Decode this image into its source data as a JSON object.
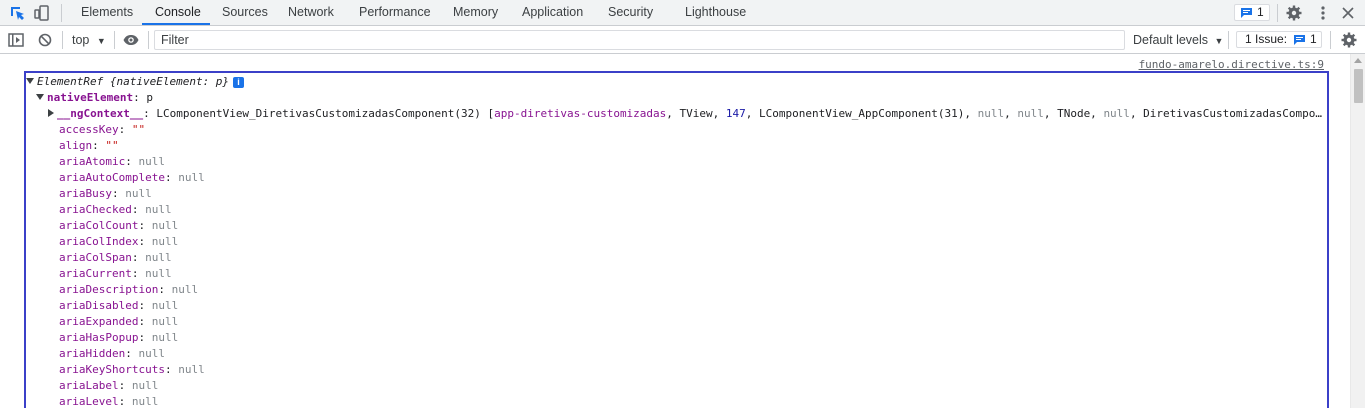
{
  "tabs": [
    {
      "label": "Elements"
    },
    {
      "label": "Console"
    },
    {
      "label": "Sources"
    },
    {
      "label": "Network"
    },
    {
      "label": "Performance"
    },
    {
      "label": "Memory"
    },
    {
      "label": "Application"
    },
    {
      "label": "Security"
    },
    {
      "label": "Lighthouse"
    }
  ],
  "active_tab": "Console",
  "messages_badge": "1",
  "toolbar": {
    "context": "top",
    "filter_placeholder": "Filter",
    "levels": "Default levels",
    "issues_label": "1 Issue:",
    "issues_count": "1"
  },
  "console": {
    "source_link": "fundo-amarelo.directive.ts:9",
    "header": "ElementRef {nativeElement: p}",
    "native_element_key": "nativeElement",
    "native_element_value": "p",
    "ng_context_key": "__ngContext__",
    "ng_context_value_parts": {
      "cls1": "LComponentView_DiretivasCustomizadasComponent(32) [",
      "sel": "app-diretivas-customizadas",
      "c1": ", TView, ",
      "n147": "147",
      "c2": ", LComponentView_AppComponent(31), ",
      "null1": "null",
      "c3": ", ",
      "null2": "null",
      "c4": ", TNode, ",
      "null3": "null",
      "c5": ", DiretivasCustomizadasCompo…"
    },
    "properties": [
      {
        "key": "accessKey",
        "value": "\"\"",
        "type": "str"
      },
      {
        "key": "align",
        "value": "\"\"",
        "type": "str"
      },
      {
        "key": "ariaAtomic",
        "value": "null",
        "type": "null"
      },
      {
        "key": "ariaAutoComplete",
        "value": "null",
        "type": "null"
      },
      {
        "key": "ariaBusy",
        "value": "null",
        "type": "null"
      },
      {
        "key": "ariaChecked",
        "value": "null",
        "type": "null"
      },
      {
        "key": "ariaColCount",
        "value": "null",
        "type": "null"
      },
      {
        "key": "ariaColIndex",
        "value": "null",
        "type": "null"
      },
      {
        "key": "ariaColSpan",
        "value": "null",
        "type": "null"
      },
      {
        "key": "ariaCurrent",
        "value": "null",
        "type": "null"
      },
      {
        "key": "ariaDescription",
        "value": "null",
        "type": "null"
      },
      {
        "key": "ariaDisabled",
        "value": "null",
        "type": "null"
      },
      {
        "key": "ariaExpanded",
        "value": "null",
        "type": "null"
      },
      {
        "key": "ariaHasPopup",
        "value": "null",
        "type": "null"
      },
      {
        "key": "ariaHidden",
        "value": "null",
        "type": "null"
      },
      {
        "key": "ariaKeyShortcuts",
        "value": "null",
        "type": "null"
      },
      {
        "key": "ariaLabel",
        "value": "null",
        "type": "null"
      },
      {
        "key": "ariaLevel",
        "value": "null",
        "type": "null"
      }
    ]
  },
  "colors": {
    "accent": "#1a73e8",
    "highlight_border": "#3b40c8",
    "property_name": "#881391",
    "null_value": "#80868b",
    "string_value": "#c41a16",
    "number_value": "#1a1aa6"
  }
}
